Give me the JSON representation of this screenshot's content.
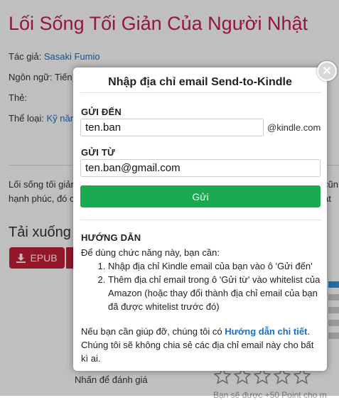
{
  "page": {
    "title": "Lối Sống Tối Giản Của Người Nhật",
    "author_label": "Tác giả:",
    "author": "Sasaki Fumio",
    "language_label": "Ngôn ngữ:",
    "language_value": "Tiến",
    "tags_label": "Thẻ:",
    "category_label": "Thể loại:",
    "category_value": "Kỹ năn",
    "desc_line1": "Lối sống tối giản",
    "desc_line2": "hạnh phúc, đó c",
    "desc_right1": "cũn",
    "desc_right2": "ạt",
    "download_title": "Tải xuống",
    "epub_label": "EPUB",
    "rate_label": "Nhấn để đánh giá",
    "bottom_text": "Bạn sẽ được +50 Point cho m"
  },
  "modal": {
    "title": "Nhập địa chỉ email Send-to-Kindle",
    "to_label": "GỬI ĐẾN",
    "to_value": "ten.ban",
    "to_suffix": "@kindle.com",
    "from_label": "GỬI TỪ",
    "from_value": "ten.ban@gmail.com",
    "send_label": "Gửi",
    "guide_title": "HƯỚNG DẪN",
    "guide_intro": "Để dùng chức năng này, bạn cần:",
    "guide_steps": [
      "Nhập địa chỉ Kindle email của bạn vào ô 'Gửi đến'",
      "Thêm địa chỉ email trong ô 'Gửi từ' vào whitelist của Amazon (hoặc thay đổi thành địa chỉ email của bạn đã được whitelist trước đó)"
    ],
    "help_prefix": "Nếu bạn cần giúp đỡ, chúng tôi có ",
    "help_link": "Hướng dẫn chi tiết",
    "help_suffix": ". Chúng tôi sẽ không chia sẻ các địa chỉ email này cho bất kì ai.",
    "close_icon": "close-icon"
  }
}
